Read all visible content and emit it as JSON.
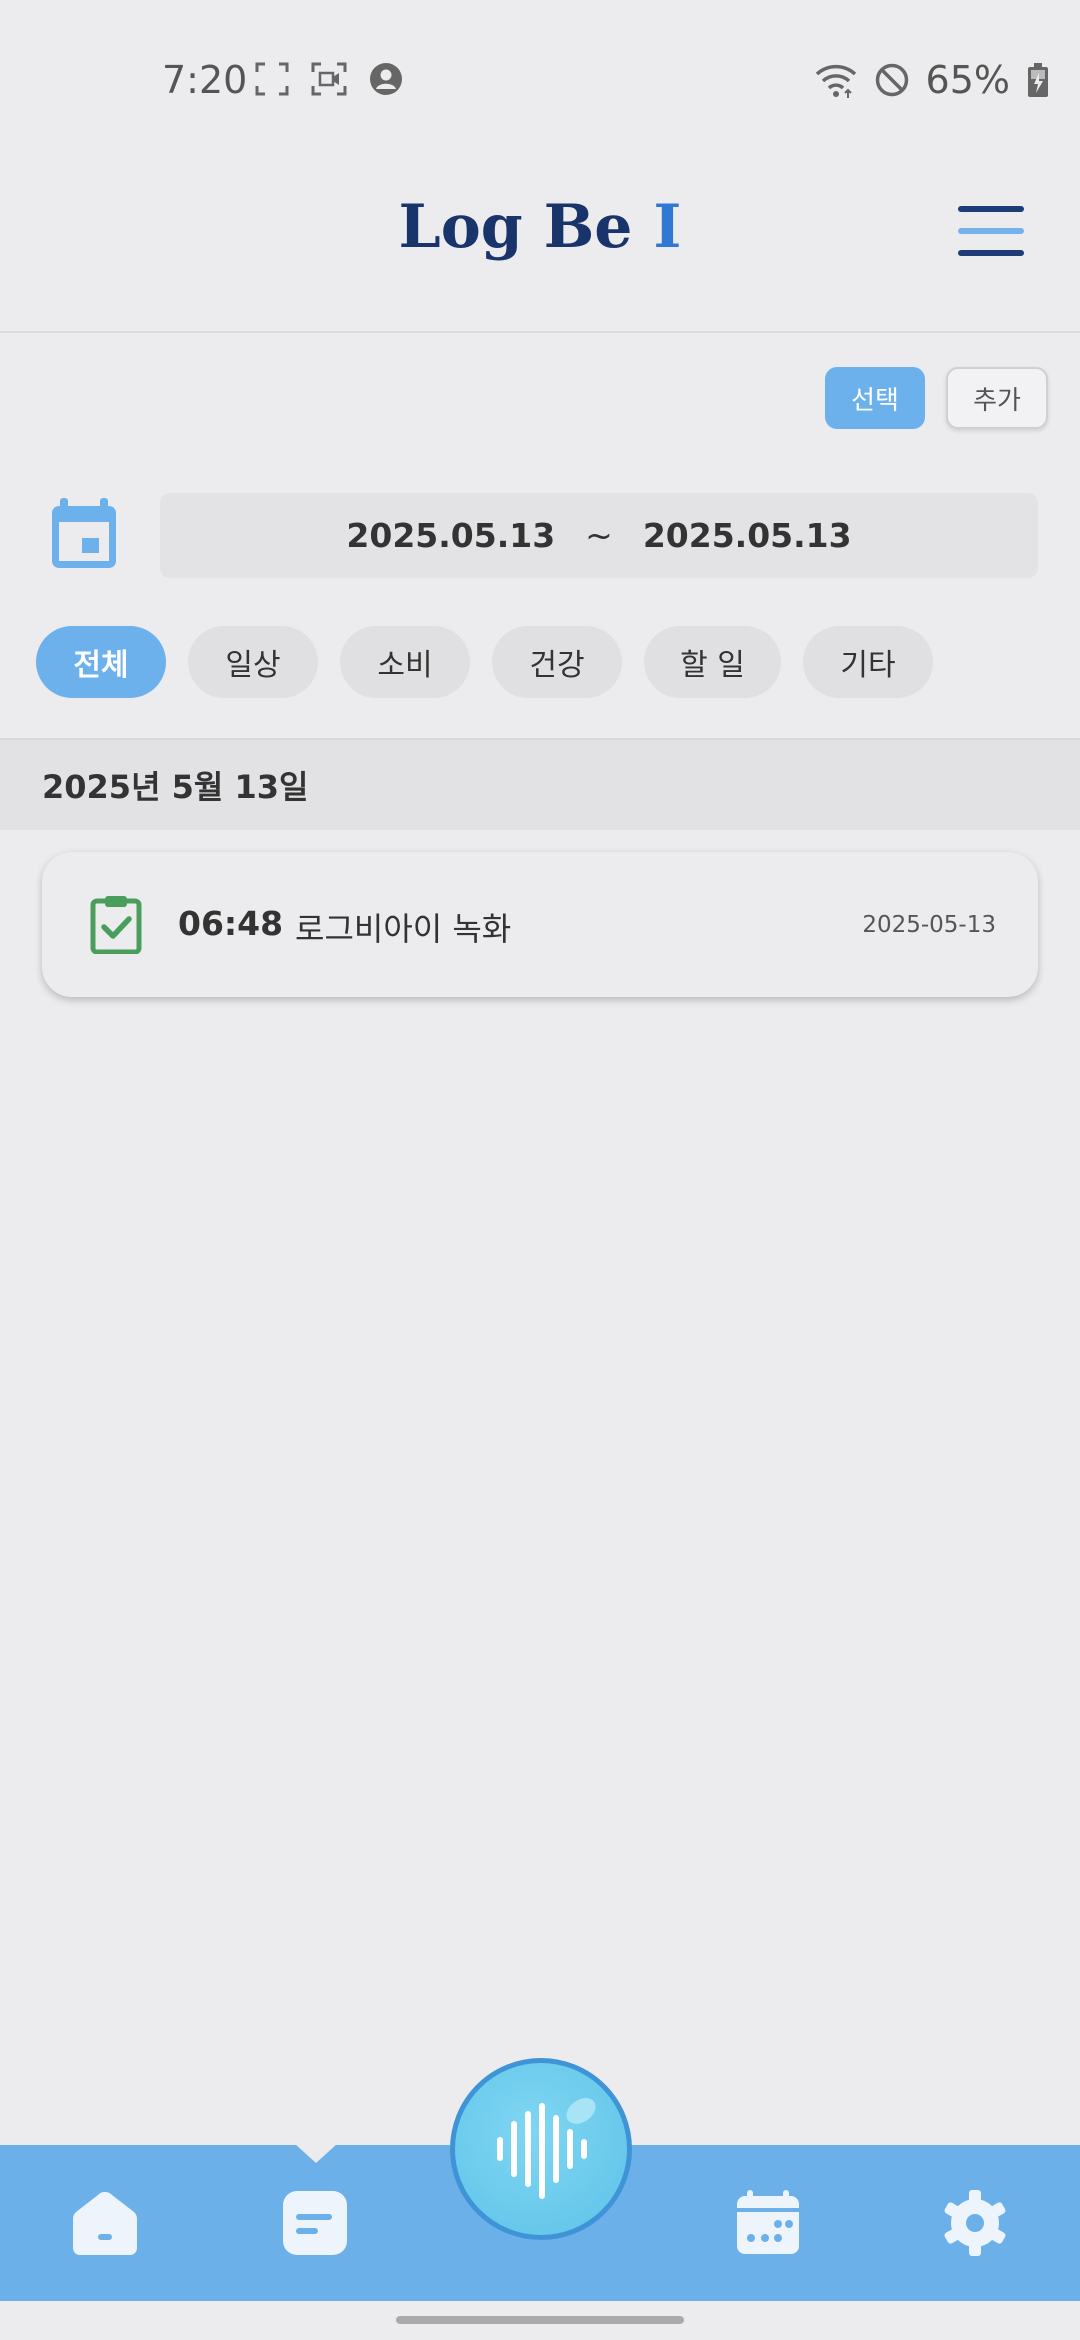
{
  "status_bar": {
    "time": "7:20",
    "battery": "65%",
    "icons_left": [
      "screenshot-icon",
      "screen-record-icon",
      "account-icon"
    ],
    "icons_right": [
      "wifi-icon",
      "do-not-disturb-icon",
      "battery-charging-icon"
    ]
  },
  "header": {
    "title_main": "Log Be ",
    "title_accent": "I",
    "title_color": "#19336b",
    "accent_color": "#2f78d4"
  },
  "actions": {
    "select_label": "선택",
    "add_label": "추가"
  },
  "date_filter": {
    "start": "2025.05.13",
    "separator": "~",
    "end": "2025.05.13"
  },
  "categories": [
    {
      "label": "전체",
      "active": true
    },
    {
      "label": "일상",
      "active": false
    },
    {
      "label": "소비",
      "active": false
    },
    {
      "label": "건강",
      "active": false
    },
    {
      "label": "할 일",
      "active": false
    },
    {
      "label": "기타",
      "active": false
    }
  ],
  "section": {
    "date_heading": "2025년 5월 13일"
  },
  "logs": [
    {
      "icon": "clipboard-check-icon",
      "time": "06:48",
      "title": "로그비아이 녹화",
      "date": "2025-05-13"
    }
  ],
  "bottom_nav": {
    "items": [
      "home-icon",
      "notes-icon",
      "voice-record-icon",
      "calendar-icon",
      "settings-icon"
    ],
    "active": "notes-icon",
    "background": "#6cb0ea"
  },
  "colors": {
    "accent": "#6cb1ec",
    "log_icon": "#4a9e5c",
    "background": "#ececee"
  }
}
